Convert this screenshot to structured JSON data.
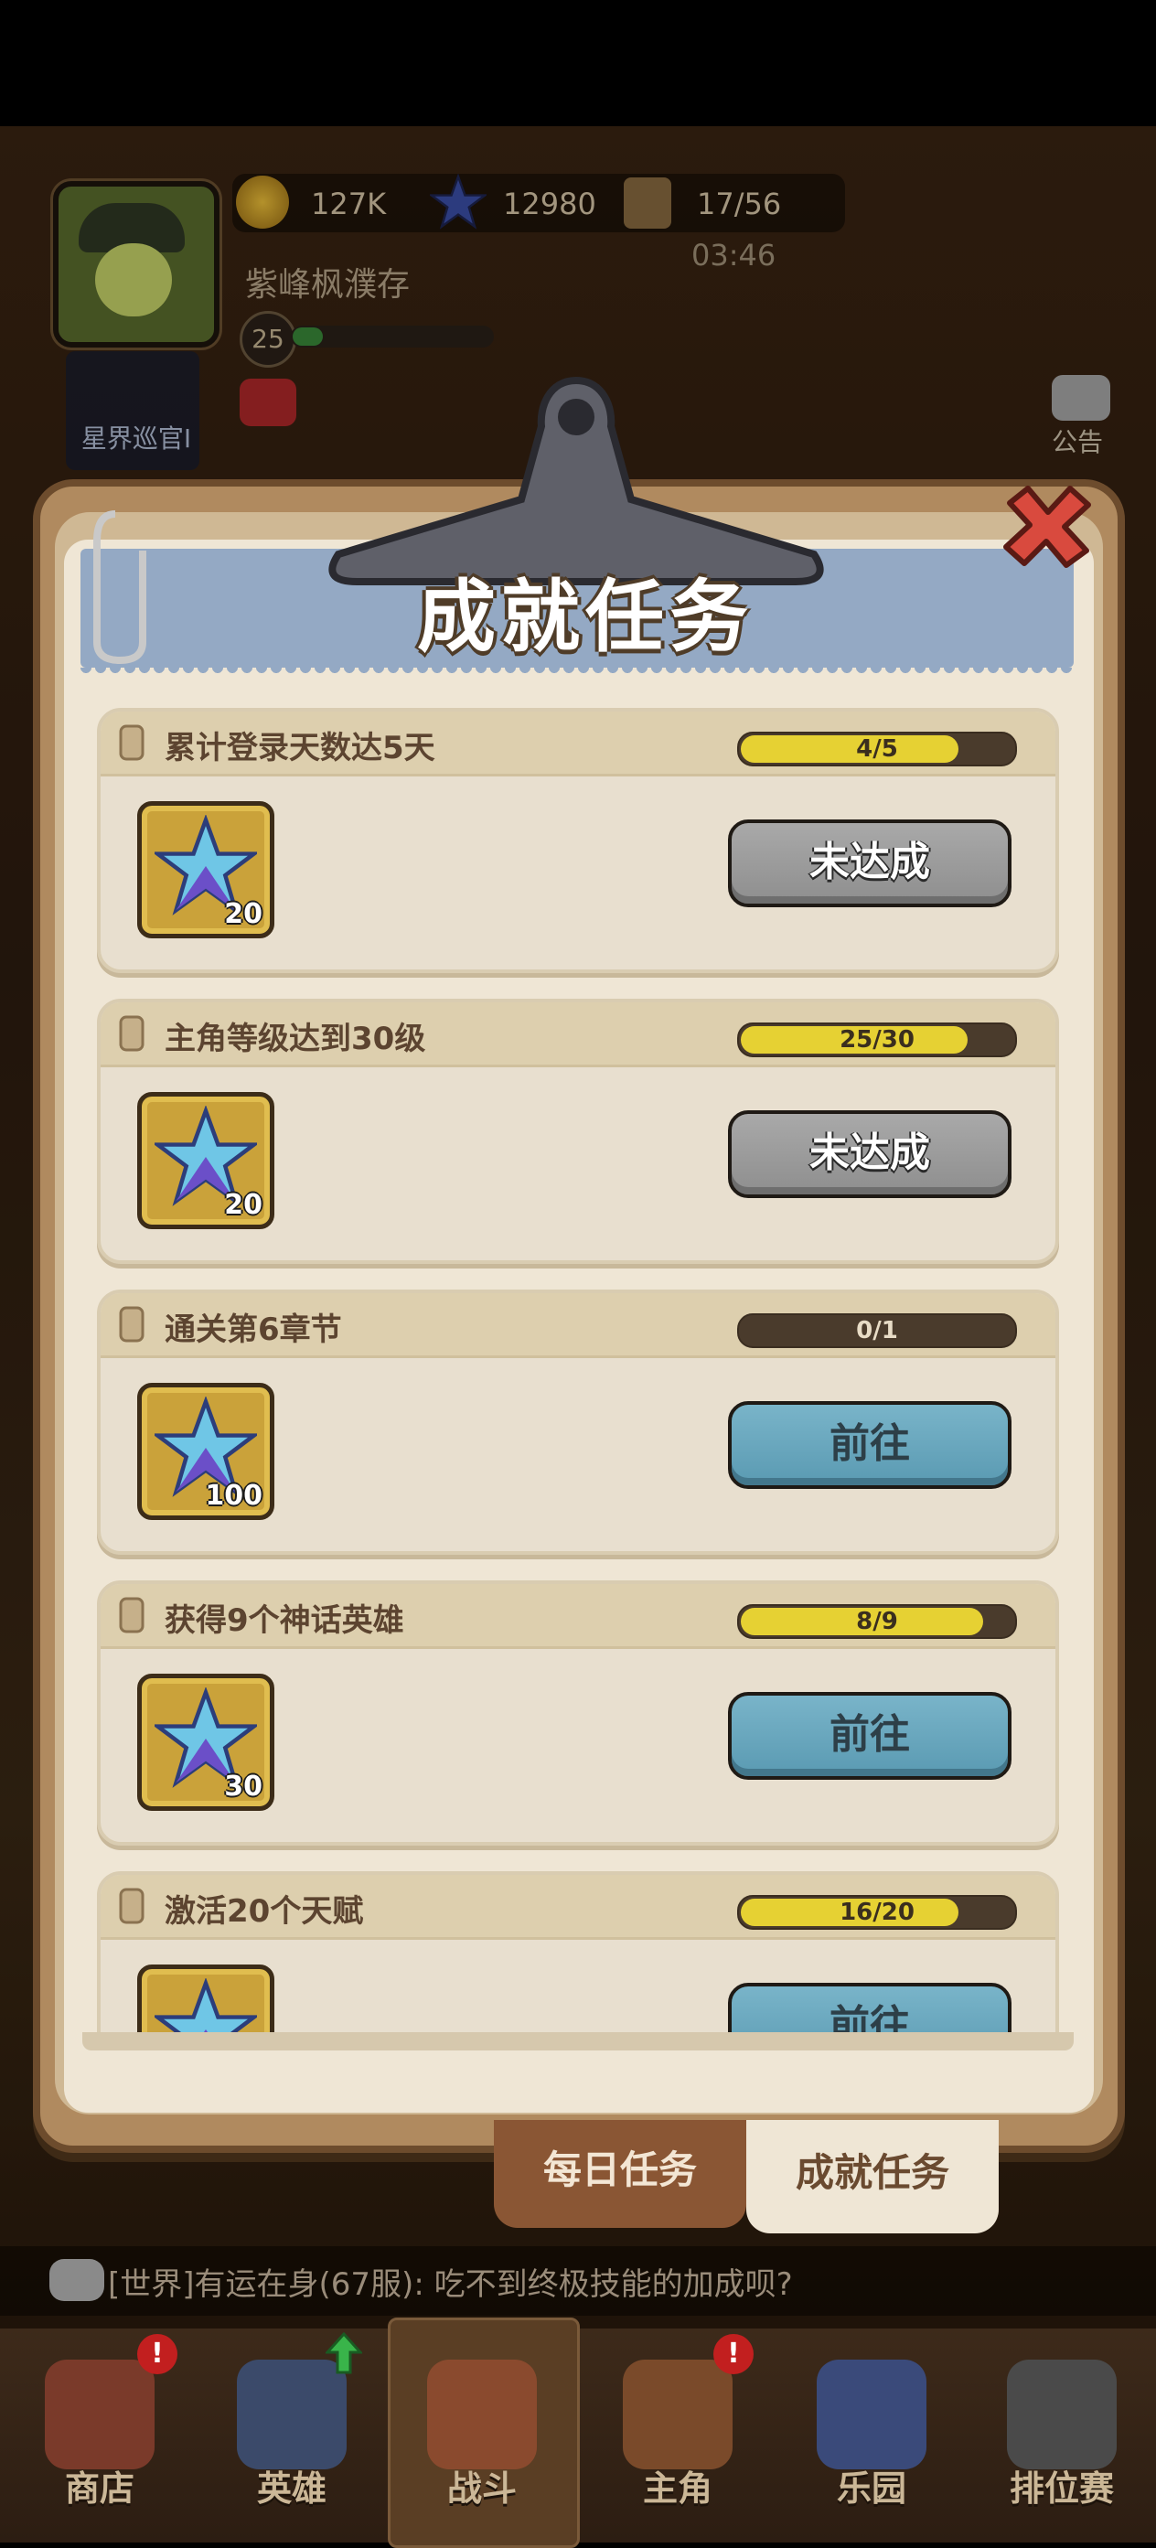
{
  "hud": {
    "gold": "127K",
    "gems": "12980",
    "stamina": "17/56",
    "timer": "03:46",
    "player_name": "紫峰枫濮存",
    "level": "25",
    "level_progress": 0.15,
    "rank_label": "星界巡官I",
    "announce_label": "公告"
  },
  "modal": {
    "title": "成就任务",
    "tasks": [
      {
        "name": "累计登录天数达5天",
        "progress_text": "4/5",
        "progress": 0.8,
        "reward_count": "20",
        "button": "未达成",
        "button_style": "grey"
      },
      {
        "name": "主角等级达到30级",
        "progress_text": "25/30",
        "progress": 0.8333,
        "reward_count": "20",
        "button": "未达成",
        "button_style": "grey"
      },
      {
        "name": "通关第6章节",
        "progress_text": "0/1",
        "progress": 0.0,
        "reward_count": "100",
        "button": "前往",
        "button_style": "blue"
      },
      {
        "name": "获得9个神话英雄",
        "progress_text": "8/9",
        "progress": 0.8889,
        "reward_count": "30",
        "button": "前往",
        "button_style": "blue"
      },
      {
        "name": "激活20个天赋",
        "progress_text": "16/20",
        "progress": 0.8,
        "reward_count": "",
        "button": "前往",
        "button_style": "blue"
      }
    ],
    "tabs": {
      "daily": "每日任务",
      "achievement": "成就任务"
    }
  },
  "chat": {
    "text": "[世界]有运在身(67服): 吃不到终极技能的加成呗?"
  },
  "nav": {
    "shop": "商店",
    "heroes": "英雄",
    "battle": "战斗",
    "protagonist": "主角",
    "park": "乐园",
    "ranked": "排位赛"
  },
  "colors": {
    "progress_fill": "#e6d133",
    "header_band": "#94a9c4",
    "button_grey": "#9b9b9b",
    "button_blue": "#6aa8be",
    "alert_badge": "#c21f1f"
  }
}
